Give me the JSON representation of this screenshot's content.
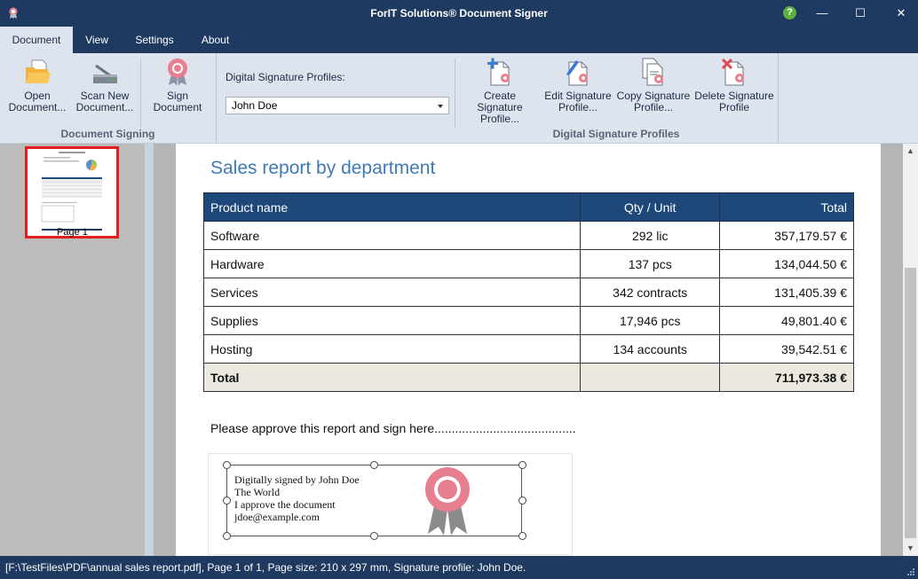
{
  "window": {
    "title": "ForIT Solutions® Document Signer",
    "help_glyph": "?",
    "minimize_glyph": "—",
    "maximize_glyph": "☐",
    "close_glyph": "✕"
  },
  "menu": {
    "tabs": [
      {
        "label": "Document",
        "active": true
      },
      {
        "label": "View",
        "active": false
      },
      {
        "label": "Settings",
        "active": false
      },
      {
        "label": "About",
        "active": false
      }
    ]
  },
  "ribbon": {
    "signing_group": {
      "label": "Document Signing",
      "open_line1": "Open",
      "open_line2": "Document...",
      "scan_line1": "Scan New",
      "scan_line2": "Document...",
      "sign_line1": "Sign",
      "sign_line2": "Document"
    },
    "profiles_group": {
      "label": "Digital Signature Profiles",
      "field_label": "Digital Signature Profiles:",
      "selected_profile": "John Doe",
      "create_line1": "Create Signature",
      "create_line2": "Profile...",
      "edit_line1": "Edit Signature",
      "edit_line2": "Profile...",
      "copy_line1": "Copy Signature",
      "copy_line2": "Profile...",
      "delete_line1": "Delete Signature",
      "delete_line2": "Profile"
    }
  },
  "thumbnails": {
    "items": [
      {
        "label": "Page 1",
        "selected": true
      }
    ]
  },
  "document": {
    "heading": "Sales report by department",
    "table": {
      "headers": [
        "Product name",
        "Qty / Unit",
        "Total"
      ],
      "rows": [
        [
          "Software",
          "292 lic",
          "357,179.57 €"
        ],
        [
          "Hardware",
          "137 pcs",
          "134,044.50 €"
        ],
        [
          "Services",
          "342 contracts",
          "131,405.39 €"
        ],
        [
          "Supplies",
          "17,946 pcs",
          "49,801.40 €"
        ],
        [
          "Hosting",
          "134 accounts",
          "39,542.51 €"
        ]
      ],
      "total_label": "Total",
      "total_qty": "",
      "total_value": "711,973.38 €"
    },
    "approve_text": "Please approve this report and sign here.........................................",
    "signature": {
      "line1": "Digitally signed by John Doe",
      "line2": "The World",
      "line3": "I approve the document",
      "line4": "jdoe@example.com"
    }
  },
  "status": {
    "text": "[F:\\TestFiles\\PDF\\annual sales report.pdf], Page 1 of 1, Page size: 210 x 297 mm, Signature profile: John Doe."
  },
  "colors": {
    "titlebar": "#1f3a60",
    "ribbon": "#dde4ee",
    "table_header": "#1f487a",
    "heading": "#3e7ab5",
    "seal": "#e87f8e",
    "selection": "#e21e1e"
  },
  "icons": {
    "app": "seal-icon",
    "open": "folder-open-icon",
    "scan": "scanner-icon",
    "sign": "seal-icon",
    "create": "document-add-icon",
    "edit": "document-edit-icon",
    "copy": "document-copy-icon",
    "delete": "document-delete-icon"
  }
}
